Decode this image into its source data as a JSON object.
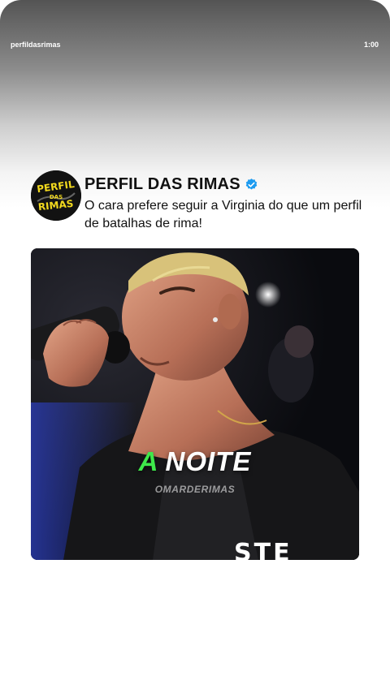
{
  "story": {
    "username": "perfildasrimas",
    "time": "1:00"
  },
  "post": {
    "author_name": "PERFIL DAS RIMAS",
    "verified_icon": "verified-badge-icon",
    "caption": "O cara prefere seguir a Virginia do que um perfil de batalhas de rima!",
    "avatar_logo_text": "PERFIL DAS RIMAS"
  },
  "video": {
    "title_accent": "A",
    "title_rest": "NOITE",
    "handle": "OMARDERIMAS",
    "shirt_text": "STE"
  },
  "colors": {
    "accent_green": "#3ee84a",
    "verified_blue": "#1d9bf0",
    "logo_yellow": "#f2d91e"
  }
}
